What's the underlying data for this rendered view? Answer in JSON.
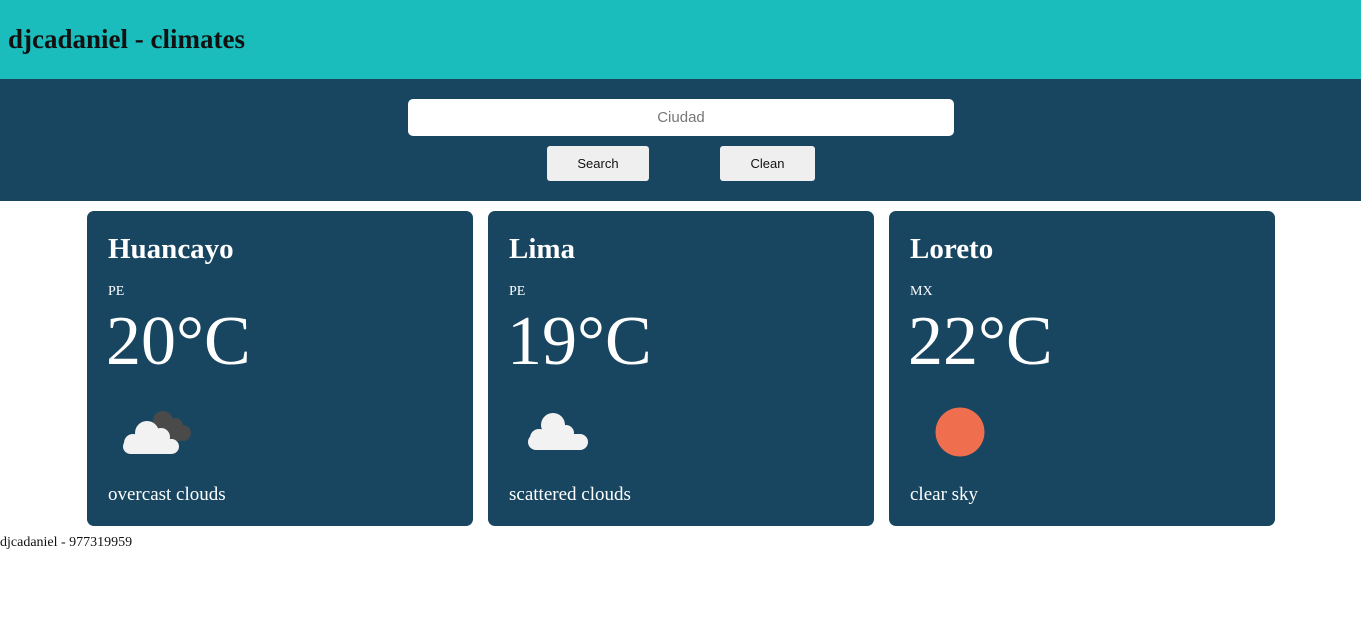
{
  "header": {
    "title": "djcadaniel - climates"
  },
  "search": {
    "placeholder": "Ciudad",
    "value": "",
    "search_label": "Search",
    "clean_label": "Clean"
  },
  "cards": [
    {
      "city": "Huancayo",
      "country": "PE",
      "temp": "20°C",
      "icon": "overcast-clouds-icon",
      "description": "overcast clouds"
    },
    {
      "city": "Lima",
      "country": "PE",
      "temp": "19°C",
      "icon": "scattered-clouds-icon",
      "description": "scattered clouds"
    },
    {
      "city": "Loreto",
      "country": "MX",
      "temp": "22°C",
      "icon": "clear-sky-icon",
      "description": "clear sky"
    }
  ],
  "footer": {
    "text": "djcadaniel - 977319959"
  },
  "colors": {
    "topbar": "#1abcbc",
    "panel": "#184661",
    "sun": "#ee6e4d",
    "cloud": "#f2f2f2",
    "dark_cloud": "#4a4a4a"
  }
}
